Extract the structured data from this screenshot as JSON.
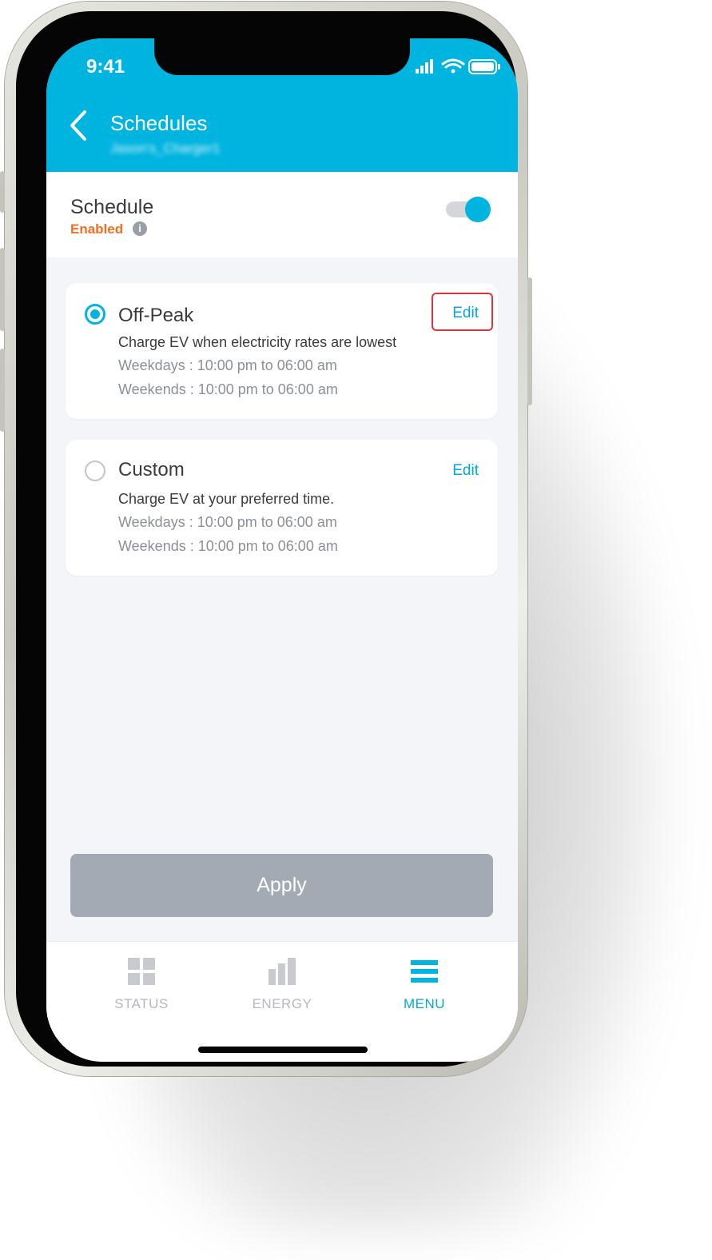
{
  "status_bar": {
    "time": "9:41"
  },
  "header": {
    "title": "Schedules",
    "subtitle": "Jason's_Charger1"
  },
  "schedule": {
    "title": "Schedule",
    "status": "Enabled",
    "enabled": true
  },
  "options": [
    {
      "title": "Off-Peak",
      "selected": true,
      "edit_label": "Edit",
      "description": "Charge EV when electricity rates are lowest",
      "weekdays": "Weekdays :  10:00 pm  to 06:00 am",
      "weekends": "Weekends :  10:00 pm  to 06:00 am"
    },
    {
      "title": "Custom",
      "selected": false,
      "edit_label": "Edit",
      "description": "Charge EV at your preferred time.",
      "weekdays": "Weekdays :  10:00 pm  to 06:00 am",
      "weekends": "Weekends :  10:00 pm  to 06:00 am"
    }
  ],
  "apply_label": "Apply",
  "tabs": [
    {
      "label": "STATUS",
      "icon": "grid-icon",
      "active": false
    },
    {
      "label": "ENERGY",
      "icon": "bar-chart-icon",
      "active": false
    },
    {
      "label": "MENU",
      "icon": "menu-icon",
      "active": true
    }
  ],
  "colors": {
    "accent": "#00b4e0",
    "enabled": "#f07022",
    "highlight": "#d9343f",
    "apply_disabled": "#a3aab3"
  }
}
